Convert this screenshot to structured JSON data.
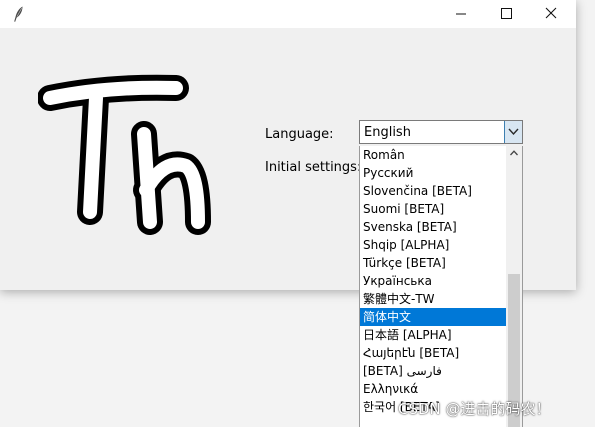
{
  "window": {
    "controls": {
      "minimize_icon": "minimize-icon",
      "maximize_icon": "maximize-icon",
      "close_icon": "close-icon"
    },
    "title_icon": "feather-icon",
    "logo": "th-logo"
  },
  "form": {
    "language_label": "Language:",
    "initial_settings_label": "Initial settings:",
    "language_selected": "English"
  },
  "dropdown": {
    "items": [
      "Român",
      "Русский",
      "Slovenčina [BETA]",
      "Suomi [BETA]",
      "Svenska [BETA]",
      "Shqip [ALPHA]",
      "Türkçe [BETA]",
      "Українська",
      "繁體中文-TW",
      "简体中文",
      "日本語  [ALPHA]",
      "Հայերէն [BETA]",
      "[BETA] فارسی",
      "Ελληνικά",
      "한국어 [BETA]"
    ],
    "highlighted": "简体中文"
  },
  "watermark": "CSDN @进击的码农！",
  "colors": {
    "selection": "#0078d7",
    "window_bg": "#f0f0f0",
    "combo_arrow_bg": "#d8e6f2"
  }
}
